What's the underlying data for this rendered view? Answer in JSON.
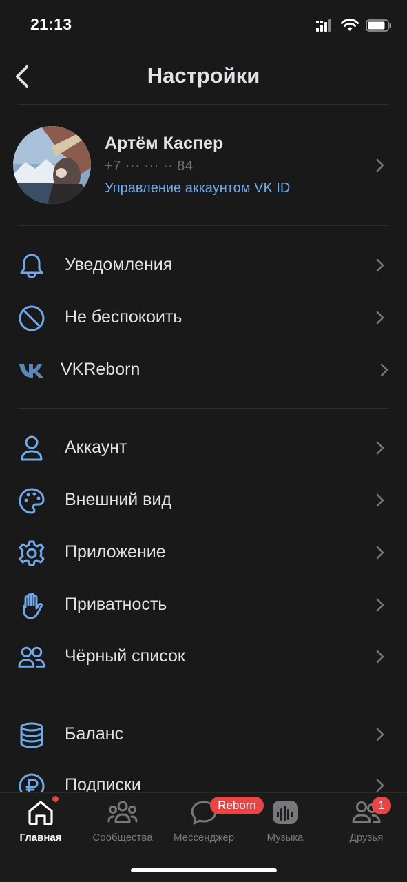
{
  "status_bar": {
    "time": "21:13"
  },
  "header": {
    "title": "Настройки"
  },
  "profile": {
    "name": "Артём Каспер",
    "phone": "+7 ··· ··· ·· 84",
    "link": "Управление аккаунтом VK ID"
  },
  "menu": {
    "group1": [
      {
        "label": "Уведомления",
        "icon": "bell-icon"
      },
      {
        "label": "Не беспокоить",
        "icon": "do-not-disturb-icon"
      },
      {
        "label": "VKReborn",
        "icon": "vk-logo-icon"
      }
    ],
    "group2": [
      {
        "label": "Аккаунт",
        "icon": "person-icon"
      },
      {
        "label": "Внешний вид",
        "icon": "palette-icon"
      },
      {
        "label": "Приложение",
        "icon": "gear-icon"
      },
      {
        "label": "Приватность",
        "icon": "hand-icon"
      },
      {
        "label": "Чёрный список",
        "icon": "users-icon"
      }
    ],
    "group3": [
      {
        "label": "Баланс",
        "icon": "coins-icon"
      },
      {
        "label": "Подписки",
        "icon": "ruble-icon"
      }
    ]
  },
  "tabs": [
    {
      "label": "Главная",
      "icon": "home-icon",
      "active": true
    },
    {
      "label": "Сообщества",
      "icon": "community-icon"
    },
    {
      "label": "Мессенджер",
      "icon": "chat-icon",
      "badge": "Reborn"
    },
    {
      "label": "Музыка",
      "icon": "music-icon"
    },
    {
      "label": "Друзья",
      "icon": "friends-icon",
      "badge": "1"
    }
  ],
  "colors": {
    "accent": "#71aaeb",
    "background": "#19191a",
    "badge": "#e64646",
    "text": "#e1e3e6",
    "secondary": "#76787a"
  }
}
